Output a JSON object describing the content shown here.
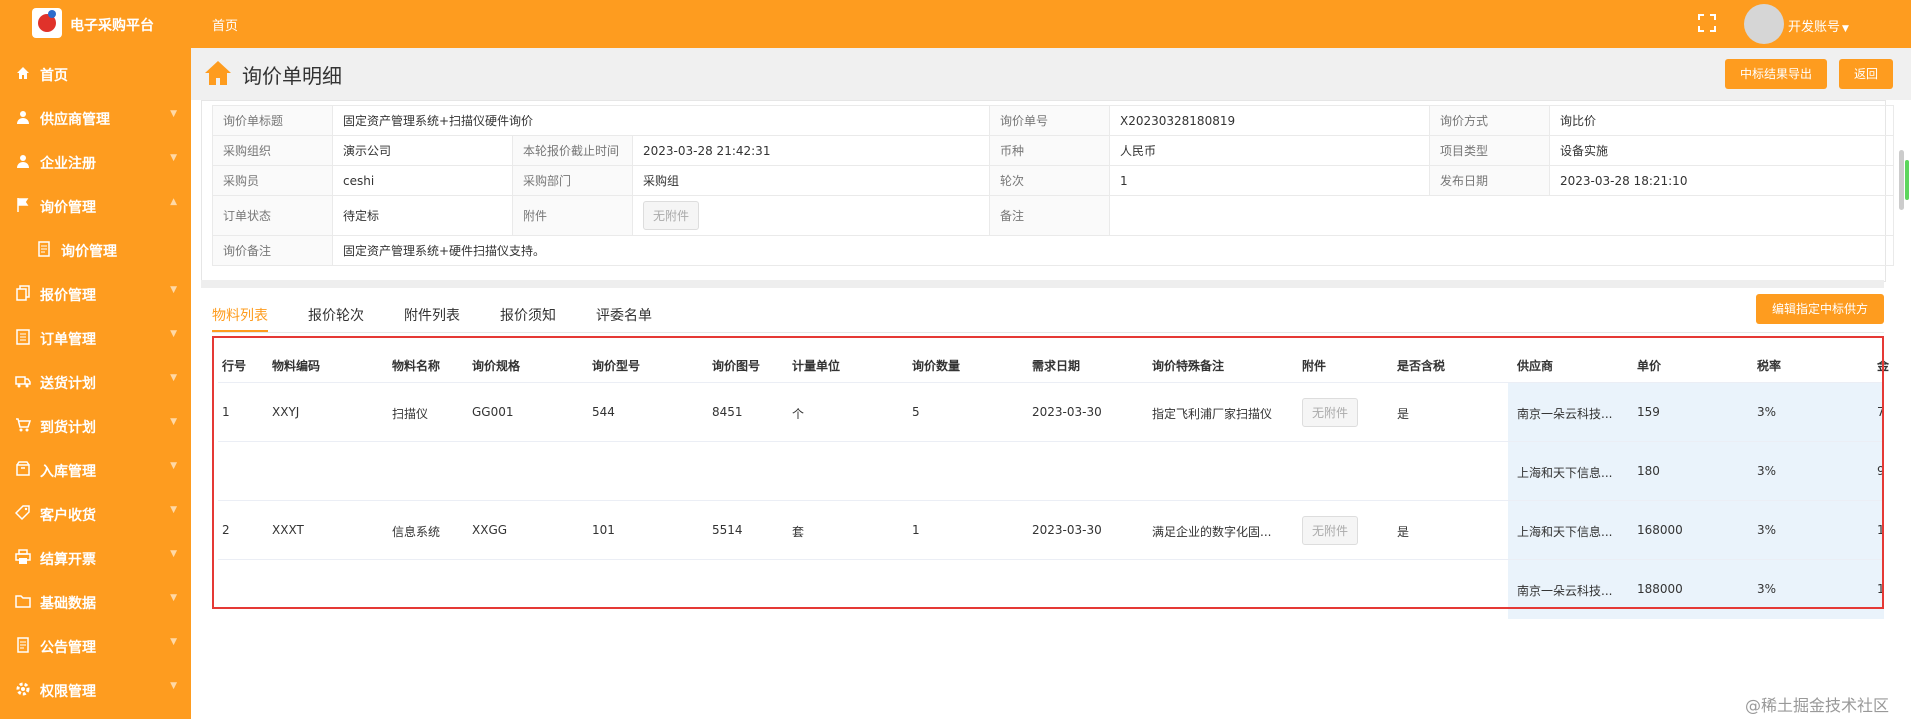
{
  "header": {
    "brand": "电子采购平台",
    "nav_home": "首页",
    "account": "开发账号",
    "colors": {
      "accent": "#fe9c1f",
      "highlight_box": "#e53935"
    }
  },
  "sidebar": {
    "items": [
      {
        "label": "首页",
        "icon": "home-icon"
      },
      {
        "label": "供应商管理",
        "icon": "user-icon"
      },
      {
        "label": "企业注册",
        "icon": "user-icon"
      },
      {
        "label": "询价管理",
        "icon": "flag-icon"
      },
      {
        "label": "询价管理",
        "icon": "document-icon"
      },
      {
        "label": "报价管理",
        "icon": "copy-icon"
      },
      {
        "label": "订单管理",
        "icon": "list-icon"
      },
      {
        "label": "送货计划",
        "icon": "truck-icon"
      },
      {
        "label": "到货计划",
        "icon": "cart-icon"
      },
      {
        "label": "入库管理",
        "icon": "box-icon"
      },
      {
        "label": "客户收货",
        "icon": "tag-icon"
      },
      {
        "label": "结算开票",
        "icon": "printer-icon"
      },
      {
        "label": "基础数据",
        "icon": "folder-icon"
      },
      {
        "label": "公告管理",
        "icon": "document-icon"
      },
      {
        "label": "权限管理",
        "icon": "gear-icon"
      }
    ]
  },
  "page": {
    "title": "询价单明细",
    "export_button": "中标结果导出",
    "back_button": "返回",
    "edit_winner_button": "编辑指定中标供方"
  },
  "info": {
    "title_label": "询价单标题",
    "title_value": "固定资产管理系统+扫描仪硬件询价",
    "no_label": "询价单号",
    "no_value": "X20230328180819",
    "method_label": "询价方式",
    "method_value": "询比价",
    "org_label": "采购组织",
    "org_value": "演示公司",
    "deadline_label": "本轮报价截止时间",
    "deadline_value": "2023-03-28 21:42:31",
    "currency_label": "币种",
    "currency_value": "人民币",
    "project_type_label": "项目类型",
    "project_type_value": "设备实施",
    "buyer_label": "采购员",
    "buyer_value": "ceshi",
    "dept_label": "采购部门",
    "dept_value": "采购组",
    "round_label": "轮次",
    "round_value": "1",
    "publish_label": "发布日期",
    "publish_value": "2023-03-28 18:21:10",
    "status_label": "订单状态",
    "status_value": "待定标",
    "attach_label": "附件",
    "attach_value": "无附件",
    "remark_label": "备注",
    "remark_value": "",
    "inquiry_remark_label": "询价备注",
    "inquiry_remark_value": "固定资产管理系统+硬件扫描仪支持。"
  },
  "tabs": [
    "物料列表",
    "报价轮次",
    "附件列表",
    "报价须知",
    "评委名单"
  ],
  "table": {
    "columns": [
      "行号",
      "物料编码",
      "物料名称",
      "询价规格",
      "询价型号",
      "询价图号",
      "计量单位",
      "询价数量",
      "需求日期",
      "询价特殊备注",
      "附件",
      "是否含税",
      "供应商",
      "单价",
      "税率",
      "金"
    ],
    "rows": [
      {
        "line": "1",
        "code": "XXYJ",
        "name": "扫描仪",
        "spec": "GG001",
        "model": "544",
        "drawing": "8451",
        "unit": "个",
        "qty": "5",
        "date": "2023-03-30",
        "remark": "指定飞利浦厂家扫描仪",
        "attach": "无附件",
        "tax": "是",
        "supplier": "南京一朵云科技...",
        "price": "159",
        "rate": "3%",
        "amount": "7"
      },
      {
        "line": "",
        "code": "",
        "name": "",
        "spec": "",
        "model": "",
        "drawing": "",
        "unit": "",
        "qty": "",
        "date": "",
        "remark": "",
        "attach": "",
        "tax": "",
        "supplier": "上海和天下信息...",
        "price": "180",
        "rate": "3%",
        "amount": "9"
      },
      {
        "line": "2",
        "code": "XXXT",
        "name": "信息系统",
        "spec": "XXGG",
        "model": "101",
        "drawing": "5514",
        "unit": "套",
        "qty": "1",
        "date": "2023-03-30",
        "remark": "满足企业的数字化固...",
        "attach": "无附件",
        "tax": "是",
        "supplier": "上海和天下信息...",
        "price": "168000",
        "rate": "3%",
        "amount": "1"
      },
      {
        "line": "",
        "code": "",
        "name": "",
        "spec": "",
        "model": "",
        "drawing": "",
        "unit": "",
        "qty": "",
        "date": "",
        "remark": "",
        "attach": "",
        "tax": "",
        "supplier": "南京一朵云科技...",
        "price": "188000",
        "rate": "3%",
        "amount": "1"
      }
    ]
  },
  "watermark": "@稀土掘金技术社区"
}
